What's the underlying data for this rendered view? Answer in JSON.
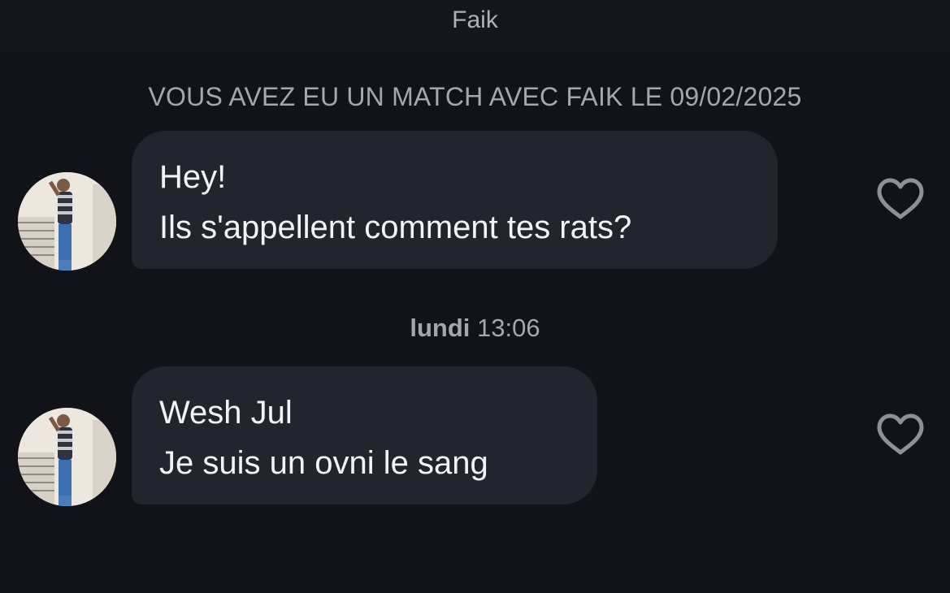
{
  "header": {
    "title": "Faik"
  },
  "match_notice": "VOUS AVEZ EU UN MATCH AVEC FAIK LE 09/02/2025",
  "timestamp": {
    "day": "lundi",
    "time": "13:06"
  },
  "messages": [
    {
      "lines": [
        "Hey!",
        "Ils s'appellent comment tes rats?"
      ],
      "liked": false,
      "like_icon": "heart-outline-icon"
    },
    {
      "lines": [
        "Wesh Jul",
        "Je suis un ovni le sang"
      ],
      "liked": false,
      "like_icon": "heart-outline-icon"
    }
  ],
  "colors": {
    "background": "#111318",
    "bubble": "#22252e",
    "text": "#f3f4f6",
    "muted_text": "#a3a7ae"
  }
}
